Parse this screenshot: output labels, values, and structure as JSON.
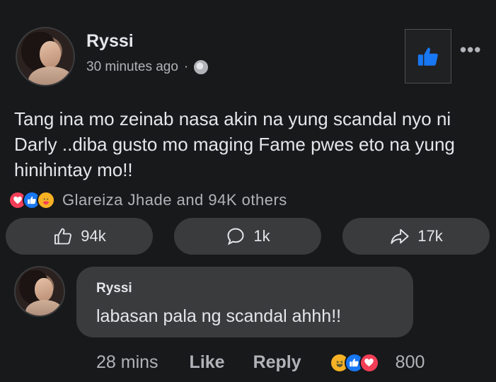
{
  "post": {
    "author": "Ryssi",
    "time": "30 minutes ago",
    "separator": "·",
    "text": "Tang ina mo zeinab nasa akin na yung scandal nyo ni Darly ..diba gusto mo maging Fame pwes eto na yung hinihintay mo!!",
    "more_label": "•••",
    "reactions": {
      "icons": [
        "heart-icon",
        "like-icon",
        "care-icon"
      ],
      "summary": "Glareiza Jhade and 94K others"
    },
    "actions": {
      "like_count": "94k",
      "comment_count": "1k",
      "share_count": "17k"
    }
  },
  "comment": {
    "author": "Ryssi",
    "text": "labasan pala ng scandal ahhh!!",
    "time": "28 mins",
    "like_label": "Like",
    "reply_label": "Reply",
    "reaction_icons": [
      "laugh-icon",
      "like-icon",
      "heart-icon"
    ],
    "reaction_count": "800"
  },
  "colors": {
    "background": "#18191a",
    "pill": "#3a3b3c",
    "accent_blue": "#1877f2",
    "heart_red": "#f33e58",
    "secondary_text": "#b0b3b8"
  }
}
